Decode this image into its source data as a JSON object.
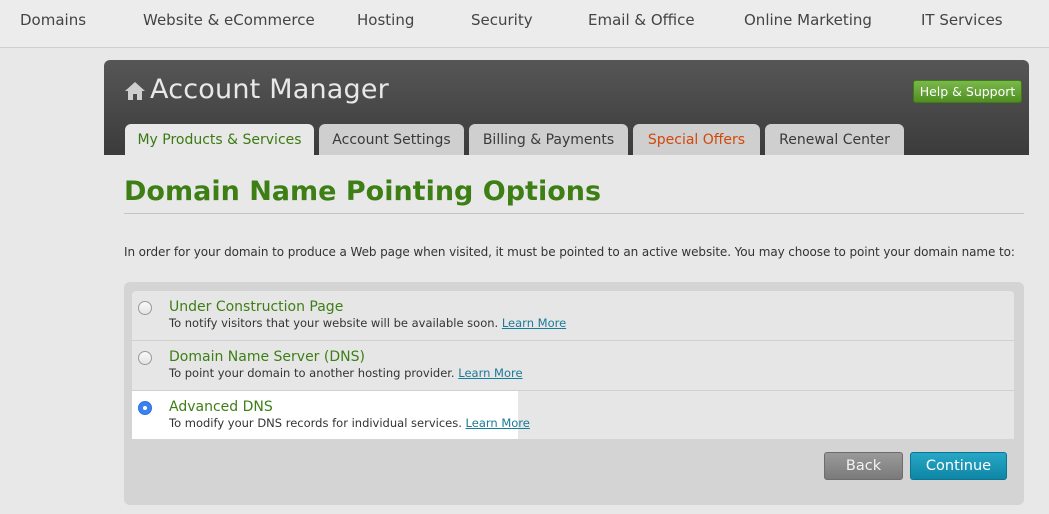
{
  "topnav": {
    "items": [
      "Domains",
      "Website & eCommerce",
      "Hosting",
      "Security",
      "Email & Office",
      "Online Marketing",
      "IT Services"
    ]
  },
  "header": {
    "title": "Account Manager",
    "help_label": "Help & Support",
    "home_icon": "home-icon"
  },
  "tabs": [
    {
      "label": "My Products & Services",
      "active": true
    },
    {
      "label": "Account Settings",
      "active": false
    },
    {
      "label": "Billing & Payments",
      "active": false
    },
    {
      "label": "Special Offers",
      "active": false
    },
    {
      "label": "Renewal Center",
      "active": false
    }
  ],
  "page": {
    "heading": "Domain Name Pointing Options",
    "intro": "In order for your domain to produce a Web page when visited, it must be pointed to an active website. You may choose to point your domain name to:"
  },
  "options": [
    {
      "title": "Under Construction Page",
      "desc": "To notify visitors that your website will be available soon.",
      "link": "Learn More",
      "selected": false
    },
    {
      "title": "Domain Name Server (DNS)",
      "desc": "To point your domain to another hosting provider.",
      "link": "Learn More",
      "selected": false
    },
    {
      "title": "Advanced DNS",
      "desc": "To modify your DNS records for individual services.",
      "link": "Learn More",
      "selected": true
    }
  ],
  "buttons": {
    "back": "Back",
    "continue": "Continue"
  },
  "colors": {
    "accent_green": "#3d7f15",
    "offers_orange": "#d2480a",
    "continue_blue": "#1596b6",
    "header_dark": "#474747"
  }
}
